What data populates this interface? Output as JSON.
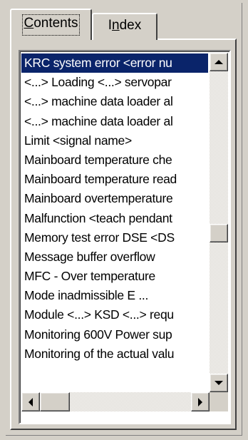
{
  "tabs": [
    {
      "label_mnemonic": "C",
      "label_rest": "ontents",
      "active": true
    },
    {
      "label_pre": "I",
      "label_mnemonic": "n",
      "label_rest": "dex",
      "active": false
    }
  ],
  "list": {
    "items": [
      "KRC system error <error nu",
      "<...> Loading <...> servopar",
      "<...> machine data loader al",
      "<...> machine data loader al",
      "Limit <signal name>",
      "Mainboard temperature che",
      "Mainboard temperature read",
      "Mainboard overtemperature",
      "Malfunction <teach pendant",
      "Memory test error DSE <DS",
      "Message buffer overflow",
      "MFC - Over temperature",
      "Mode inadmissible E ...",
      "Module <...> KSD <...> requ",
      "Monitoring 600V Power sup",
      "Monitoring of the actual valu"
    ],
    "selected_index": 0
  },
  "icons": {
    "scroll_up": "arrow-up-icon",
    "scroll_down": "arrow-down-icon",
    "scroll_left": "arrow-left-icon",
    "scroll_right": "arrow-right-icon"
  },
  "colors": {
    "face": "#d4d0c8",
    "selection": "#0a246a",
    "selection_text": "#ffffff"
  }
}
